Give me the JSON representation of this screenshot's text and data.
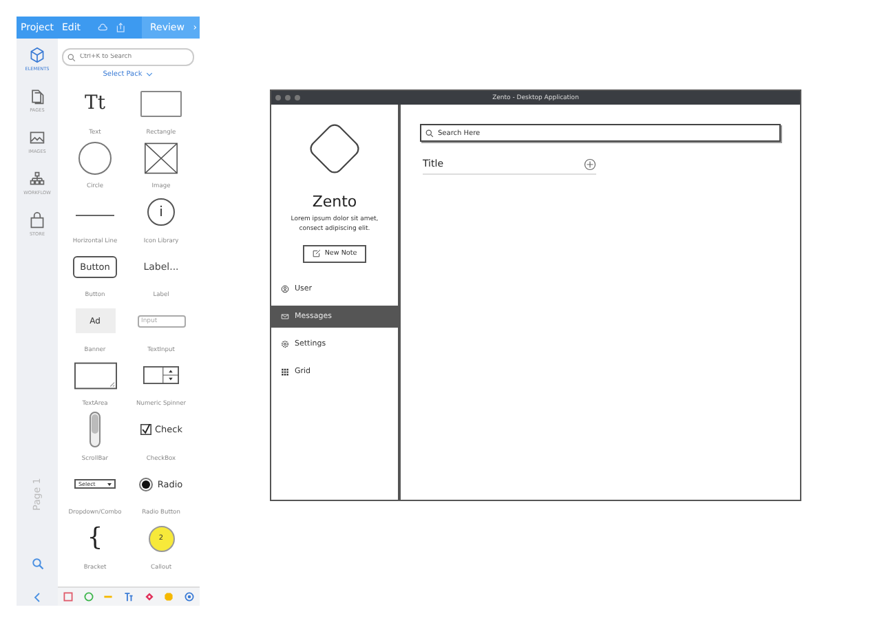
{
  "topbar": {
    "menus": [
      "Project",
      "Edit"
    ],
    "review": "Review",
    "review_chevron": "›"
  },
  "sidenav": [
    {
      "label": "ELEMENTS",
      "selected": true
    },
    {
      "label": "PAGES",
      "selected": false
    },
    {
      "label": "IMAGES",
      "selected": false
    },
    {
      "label": "WORKFLOW",
      "selected": false
    },
    {
      "label": "STORE",
      "selected": false
    }
  ],
  "page_label": "Page 1",
  "search": {
    "placeholder": "Ctrl+K to Search"
  },
  "pack": "Select Pack",
  "palette": [
    {
      "kind": "text",
      "preview": "Tt",
      "label": "Text"
    },
    {
      "kind": "circle",
      "label": "Circle"
    },
    {
      "kind": "line",
      "label": "Horizontal Line"
    },
    {
      "kind": "button",
      "preview": "Button",
      "label": "Button"
    },
    {
      "kind": "banner",
      "preview": "Ad",
      "label": "Banner"
    },
    {
      "kind": "textarea",
      "label": "TextArea"
    },
    {
      "kind": "scrollbar",
      "label": "ScrollBar"
    },
    {
      "kind": "dropdown",
      "preview": "Select",
      "label": "Dropdown/Combo"
    },
    {
      "kind": "bracket",
      "preview": "{",
      "label": "Bracket"
    },
    {
      "kind": "rectangle",
      "label": "Rectangle"
    },
    {
      "kind": "image",
      "label": "Image"
    },
    {
      "kind": "info",
      "preview": "i",
      "label": "Icon Library"
    },
    {
      "kind": "labeltext",
      "preview": "Label...",
      "label": "Label"
    },
    {
      "kind": "input",
      "preview": "Input",
      "label": "TextInput"
    },
    {
      "kind": "spinner",
      "label": "Numeric Spinner"
    },
    {
      "kind": "checkbox",
      "preview": "Check",
      "checked": true,
      "label": "CheckBox"
    },
    {
      "kind": "radio",
      "preview": "Radio",
      "selected": true,
      "label": "Radio Button"
    },
    {
      "kind": "callout",
      "preview": "2",
      "label": "Callout"
    }
  ],
  "app": {
    "title": "Zento - Desktop Application",
    "name": "Zento",
    "tagline": "Lorem ipsum dolor sit amet, consect adipiscing elit.",
    "new_note": "New Note",
    "nav": [
      {
        "label": "User",
        "selected": false
      },
      {
        "label": "Messages",
        "selected": true
      },
      {
        "label": "Settings",
        "selected": false
      },
      {
        "label": "Grid",
        "selected": false
      }
    ],
    "search": {
      "placeholder": "Search Here"
    },
    "list_title": "Title"
  }
}
